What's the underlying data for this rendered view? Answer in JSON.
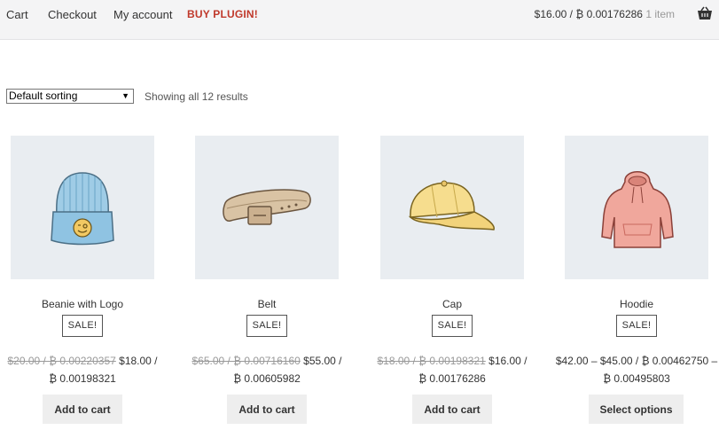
{
  "nav": {
    "cart": "Cart",
    "checkout": "Checkout",
    "my_account": "My account",
    "buy_plugin": "BUY PLUGIN!"
  },
  "cart_summary": {
    "total": "$16.00 / ₿ 0.00176286",
    "items": "1 item"
  },
  "shop": {
    "sorting_selected": "Default sorting",
    "result_count": "Showing all 12 results"
  },
  "products": [
    {
      "name": "Beanie with Logo",
      "badge": "SALE!",
      "price_old": "$20.00 / ₿ 0.00220357",
      "price_new": "$18.00 /",
      "price_btc": "₿ 0.00198321",
      "button": "Add to cart",
      "icon": "beanie-image"
    },
    {
      "name": "Belt",
      "badge": "SALE!",
      "price_old": "$65.00 / ₿ 0.00716160",
      "price_new": "$55.00 /",
      "price_btc": "₿ 0.00605982",
      "button": "Add to cart",
      "icon": "belt-image"
    },
    {
      "name": "Cap",
      "badge": "SALE!",
      "price_old": "$18.00 / ₿ 0.00198321",
      "price_new": "$16.00 /",
      "price_btc": "₿ 0.00176286",
      "button": "Add to cart",
      "icon": "cap-image"
    },
    {
      "name": "Hoodie",
      "badge": "SALE!",
      "price_range": "$42.00 – $45.00 / ₿ 0.00462750 –",
      "price_btc": "₿ 0.00495803",
      "button": "Select options",
      "icon": "hoodie-image"
    }
  ],
  "colors": {
    "buy_plugin": "#c0392b",
    "topbar_bg": "#f4f4f5",
    "thumb_bg": "#e9edf1",
    "button_bg": "#eeeeee"
  }
}
